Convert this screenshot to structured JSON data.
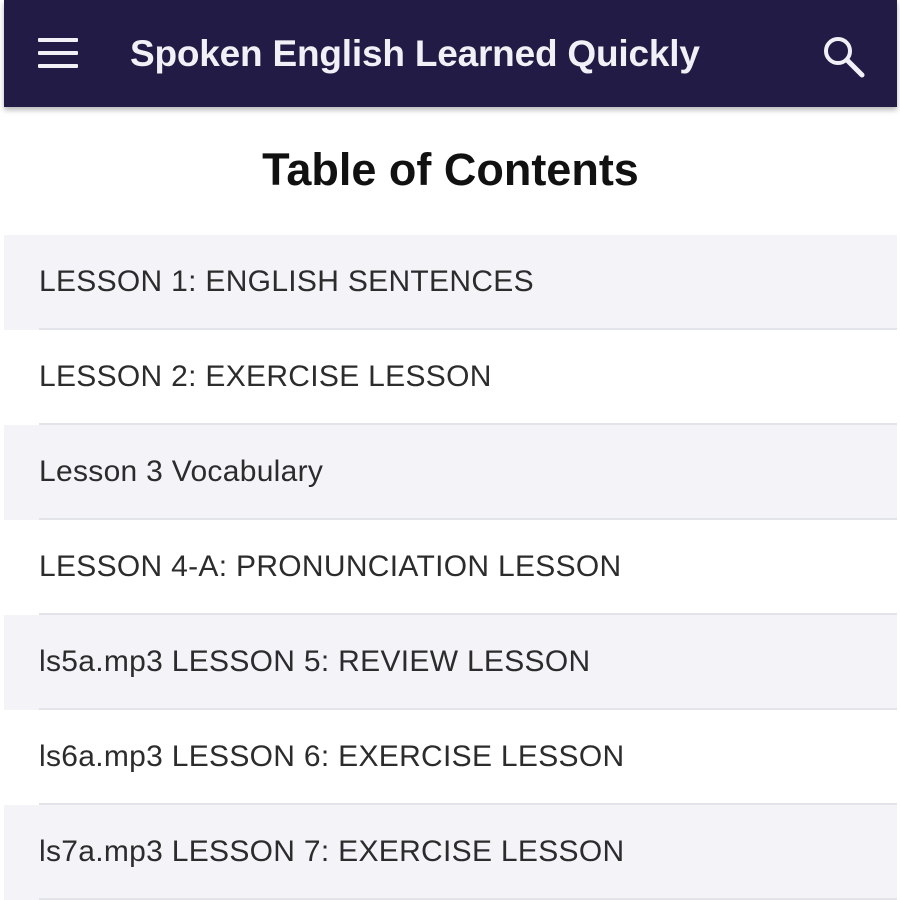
{
  "app_bar": {
    "title": "Spoken English Learned Quickly",
    "menu_icon": "hamburger-menu-icon",
    "search_icon": "search-icon",
    "background": "#221b45",
    "title_color": "#f1f0f6"
  },
  "main": {
    "heading": "Table of Contents",
    "row_colors": [
      "#f3f3f8",
      "#ffffff"
    ],
    "items": [
      {
        "label": "LESSON 1: ENGLISH SENTENCES"
      },
      {
        "label": "LESSON 2: EXERCISE LESSON"
      },
      {
        "label": "Lesson 3 Vocabulary"
      },
      {
        "label": "LESSON 4-A: PRONUNCIATION LESSON"
      },
      {
        "label": "ls5a.mp3 LESSON 5: REVIEW LESSON"
      },
      {
        "label": "ls6a.mp3 LESSON 6: EXERCISE LESSON"
      },
      {
        "label": "ls7a.mp3 LESSON 7: EXERCISE LESSON"
      }
    ]
  }
}
